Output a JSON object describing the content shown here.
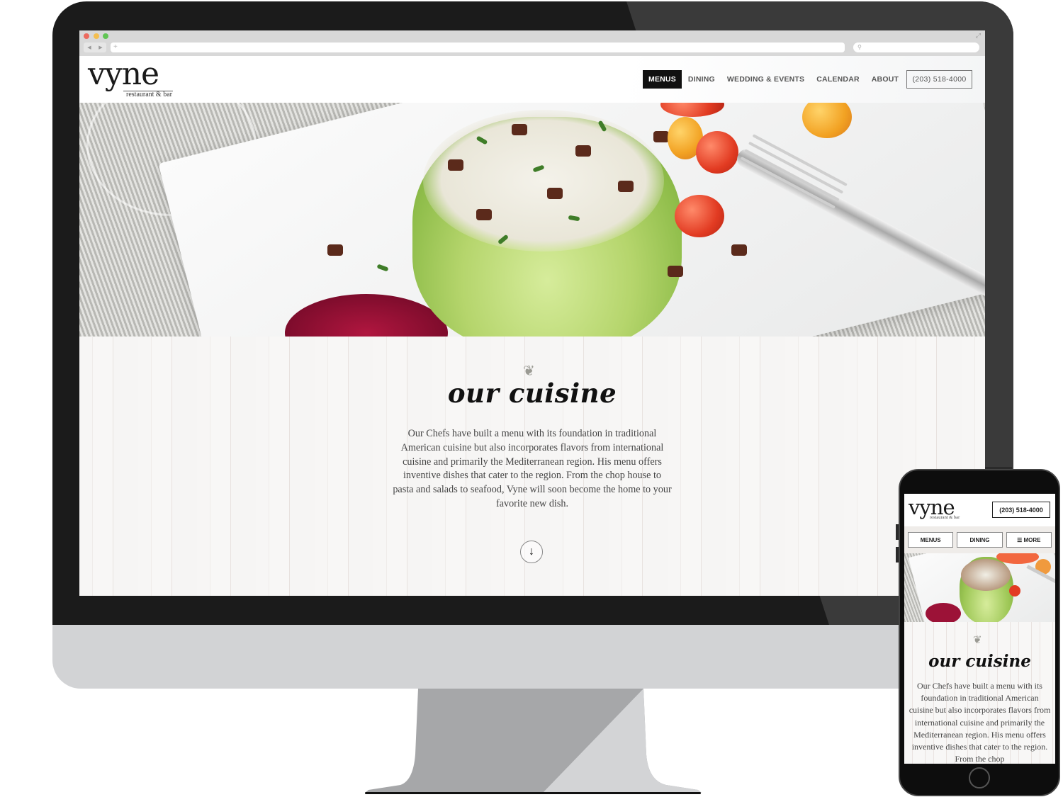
{
  "browser": {
    "url_placeholder": "+",
    "back_glyph": "◀",
    "forward_glyph": "▶",
    "search_glyph": "⚲",
    "expand_glyph": "⤢"
  },
  "site": {
    "logo": {
      "word": "vyne",
      "tagline": "restaurant & bar"
    },
    "nav": [
      {
        "label": "MENUS",
        "active": true
      },
      {
        "label": "DINING",
        "active": false
      },
      {
        "label": "WEDDING & EVENTS",
        "active": false
      },
      {
        "label": "CALENDAR",
        "active": false
      },
      {
        "label": "ABOUT",
        "active": false
      }
    ],
    "phone": "(203) 518-4000",
    "section": {
      "icon": "vine-leaf-icon",
      "icon_glyph": "❦",
      "title": "our cuisine",
      "text": "Our Chefs have built a menu with its foundation in traditional American cuisine but also incorporates flavors from international cuisine and primarily the Mediterranean region. His menu offers inventive dishes that cater to the region. From the chop house to pasta and salads to seafood, Vyne will soon become the home to your favorite new dish.",
      "scroll_glyph": "↓"
    }
  },
  "mobile": {
    "phone": "(203) 518-4000",
    "nav": [
      {
        "label": "MENUS"
      },
      {
        "label": "DINING"
      },
      {
        "label": "☰ MORE"
      }
    ],
    "visible_text": "Our Chefs have built a menu with its foundation in traditional American cuisine but also incorporates flavors from international cuisine and primarily the Mediterranean region. His menu offers inventive dishes that cater to the region. From the chop"
  },
  "colors": {
    "active_nav_bg": "#111111",
    "nav_text": "#555555",
    "bezel": "#1b1b1b",
    "chin": "#d2d3d5",
    "stand_dark": "#a6a7a9",
    "stand_light": "#d3d4d6"
  }
}
